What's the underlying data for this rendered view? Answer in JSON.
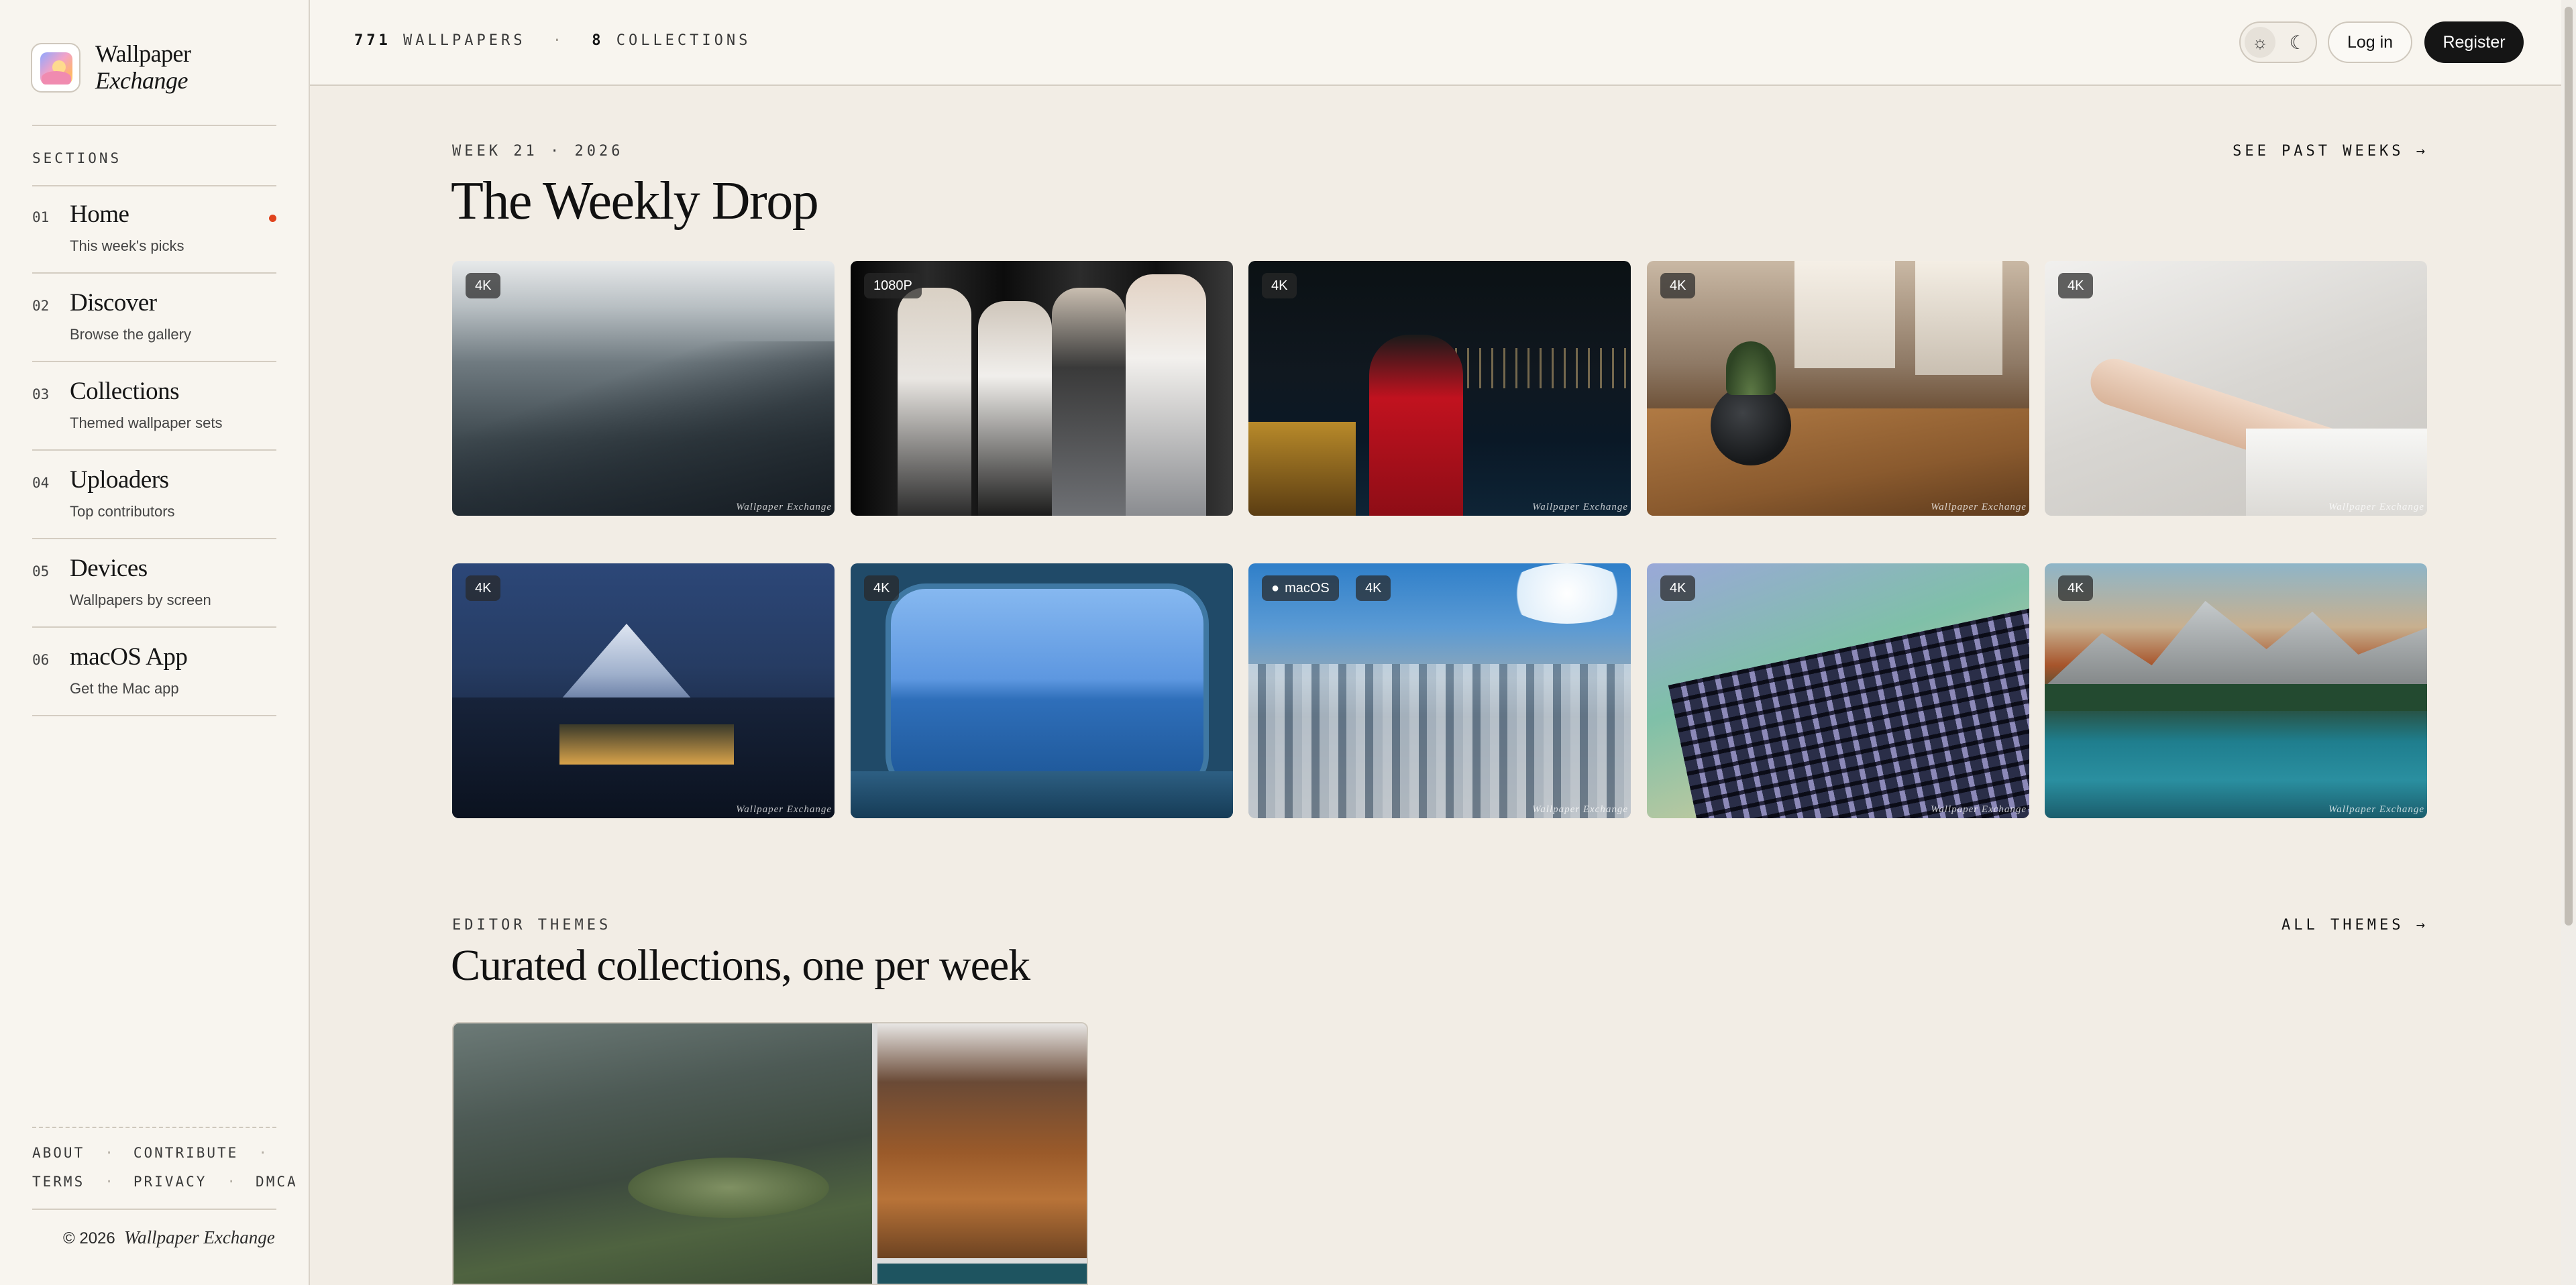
{
  "brand": {
    "line1": "Wallpaper",
    "line2": "Exchange"
  },
  "sidebar": {
    "sections_label": "SECTIONS",
    "items": [
      {
        "num": "01",
        "title": "Home",
        "subtitle": "This week's picks",
        "active": true
      },
      {
        "num": "02",
        "title": "Discover",
        "subtitle": "Browse the gallery"
      },
      {
        "num": "03",
        "title": "Collections",
        "subtitle": "Themed wallpaper sets"
      },
      {
        "num": "04",
        "title": "Uploaders",
        "subtitle": "Top contributors"
      },
      {
        "num": "05",
        "title": "Devices",
        "subtitle": "Wallpapers by screen"
      },
      {
        "num": "06",
        "title": "macOS App",
        "subtitle": "Get the Mac app"
      }
    ],
    "footer": {
      "about": "ABOUT",
      "contribute": "CONTRIBUTE",
      "terms": "TERMS",
      "privacy": "PRIVACY",
      "dmca": "DMCA",
      "separator": "·"
    },
    "copyright": {
      "text": "© 2026",
      "brand": "Wallpaper Exchange"
    }
  },
  "topbar": {
    "wallpaper_count": "771",
    "wallpaper_label": "WALLPAPERS",
    "dot": "·",
    "collection_count": "8",
    "collection_label": "COLLECTIONS",
    "light_icon": "sun-icon",
    "dark_icon": "moon-icon",
    "login_label": "Log in",
    "register_label": "Register"
  },
  "weekly": {
    "eyebrow": "WEEK 21 · 2026",
    "title": "The Weekly Drop",
    "link": "SEE PAST WEEKS →",
    "watermark": "Wallpaper Exchange",
    "wallpapers": [
      {
        "res": "4K"
      },
      {
        "res": "1080P"
      },
      {
        "res": "4K"
      },
      {
        "res": "4K"
      },
      {
        "res": "4K"
      },
      {
        "res": "4K"
      },
      {
        "res": "4K"
      },
      {
        "res": "4K",
        "platform": "macOS"
      },
      {
        "res": "4K"
      },
      {
        "res": "4K"
      }
    ]
  },
  "themes": {
    "eyebrow": "EDITOR THEMES",
    "title": "Curated collections, one per week",
    "link": "ALL THEMES →"
  },
  "colors": {
    "accent_dot": "#e0431d",
    "register_bg": "#151515",
    "page_bg": "#f2ede5"
  }
}
